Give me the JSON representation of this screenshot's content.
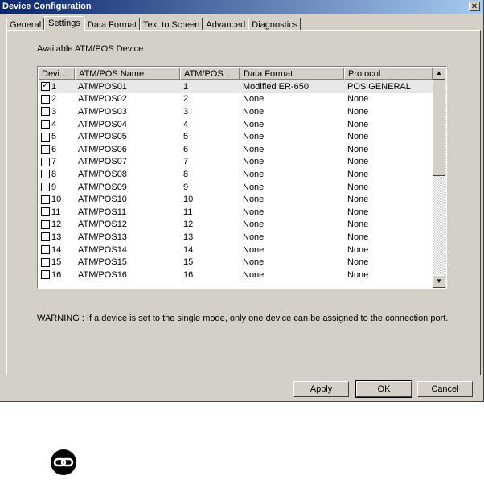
{
  "window": {
    "title": "Device Configuration",
    "close_glyph": "✕"
  },
  "tabs": [
    {
      "label": "General"
    },
    {
      "label": "Settings",
      "active": true
    },
    {
      "label": "Data Format"
    },
    {
      "label": "Text to Screen"
    },
    {
      "label": "Advanced"
    },
    {
      "label": "Diagnostics"
    }
  ],
  "section_label": "Available ATM/POS Device",
  "table": {
    "columns": [
      "Devi...",
      "ATM/POS Name",
      "ATM/POS ...",
      "Data Format",
      "Protocol"
    ],
    "rows": [
      {
        "checked": true,
        "device": "1",
        "name": "ATM/POS01",
        "atm_pos_no": "1",
        "data_format": "Modified ER-650",
        "protocol": "POS GENERAL"
      },
      {
        "checked": false,
        "device": "2",
        "name": "ATM/POS02",
        "atm_pos_no": "2",
        "data_format": "None",
        "protocol": "None"
      },
      {
        "checked": false,
        "device": "3",
        "name": "ATM/POS03",
        "atm_pos_no": "3",
        "data_format": "None",
        "protocol": "None"
      },
      {
        "checked": false,
        "device": "4",
        "name": "ATM/POS04",
        "atm_pos_no": "4",
        "data_format": "None",
        "protocol": "None"
      },
      {
        "checked": false,
        "device": "5",
        "name": "ATM/POS05",
        "atm_pos_no": "5",
        "data_format": "None",
        "protocol": "None"
      },
      {
        "checked": false,
        "device": "6",
        "name": "ATM/POS06",
        "atm_pos_no": "6",
        "data_format": "None",
        "protocol": "None"
      },
      {
        "checked": false,
        "device": "7",
        "name": "ATM/POS07",
        "atm_pos_no": "7",
        "data_format": "None",
        "protocol": "None"
      },
      {
        "checked": false,
        "device": "8",
        "name": "ATM/POS08",
        "atm_pos_no": "8",
        "data_format": "None",
        "protocol": "None"
      },
      {
        "checked": false,
        "device": "9",
        "name": "ATM/POS09",
        "atm_pos_no": "9",
        "data_format": "None",
        "protocol": "None"
      },
      {
        "checked": false,
        "device": "10",
        "name": "ATM/POS10",
        "atm_pos_no": "10",
        "data_format": "None",
        "protocol": "None"
      },
      {
        "checked": false,
        "device": "11",
        "name": "ATM/POS11",
        "atm_pos_no": "11",
        "data_format": "None",
        "protocol": "None"
      },
      {
        "checked": false,
        "device": "12",
        "name": "ATM/POS12",
        "atm_pos_no": "12",
        "data_format": "None",
        "protocol": "None"
      },
      {
        "checked": false,
        "device": "13",
        "name": "ATM/POS13",
        "atm_pos_no": "13",
        "data_format": "None",
        "protocol": "None"
      },
      {
        "checked": false,
        "device": "14",
        "name": "ATM/POS14",
        "atm_pos_no": "14",
        "data_format": "None",
        "protocol": "None"
      },
      {
        "checked": false,
        "device": "15",
        "name": "ATM/POS15",
        "atm_pos_no": "15",
        "data_format": "None",
        "protocol": "None"
      },
      {
        "checked": false,
        "device": "16",
        "name": "ATM/POS16",
        "atm_pos_no": "16",
        "data_format": "None",
        "protocol": "None"
      }
    ]
  },
  "scrollbar": {
    "up_glyph": "▲",
    "down_glyph": "▼"
  },
  "warning": "WARNING : If a device is set to the single mode, only one device can be assigned to the connection port.",
  "buttons": {
    "apply": "Apply",
    "ok": "OK",
    "cancel": "Cancel"
  },
  "icons": {
    "checkbox_check": "✓",
    "link_badge": "link-icon"
  },
  "colors": {
    "titlebar_start": "#0a246a",
    "titlebar_end": "#a6caf0",
    "dialog_bg": "#d4d0c8"
  }
}
